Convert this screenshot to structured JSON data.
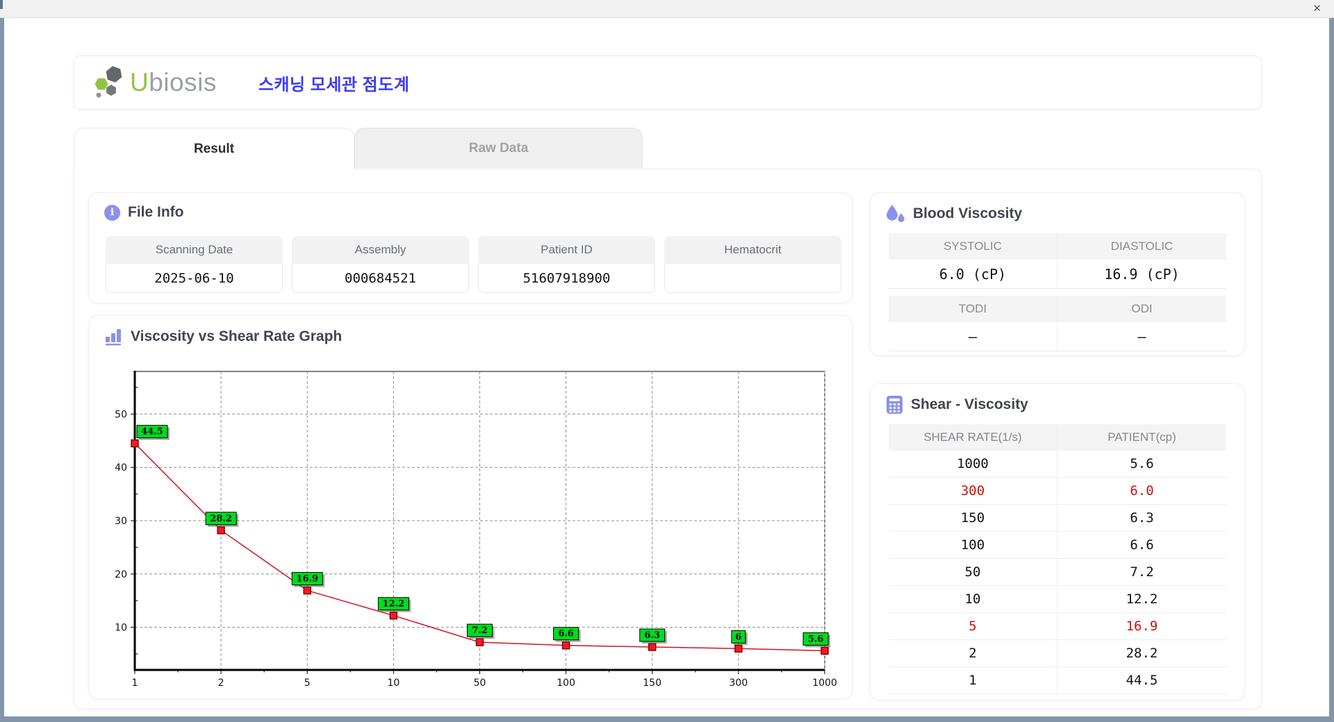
{
  "window": {
    "close_glyph": "✕"
  },
  "header": {
    "brand_u": "U",
    "brand_rest": "biosis",
    "title_ko": "스캐닝 모세관 점도계"
  },
  "tabs": [
    {
      "label": "Result",
      "active": true
    },
    {
      "label": "Raw Data",
      "active": false
    }
  ],
  "file_info": {
    "title": "File Info",
    "fields": [
      {
        "label": "Scanning Date",
        "value": "2025-06-10"
      },
      {
        "label": "Assembly",
        "value": "000684521"
      },
      {
        "label": "Patient ID",
        "value": "51607918900"
      },
      {
        "label": "Hematocrit",
        "value": ""
      }
    ]
  },
  "blood_viscosity": {
    "title": "Blood Viscosity",
    "groups": [
      {
        "cells": [
          {
            "label": "SYSTOLIC",
            "value": "6.0 (cP)"
          },
          {
            "label": "DIASTOLIC",
            "value": "16.9 (cP)"
          }
        ]
      },
      {
        "cells": [
          {
            "label": "TODI",
            "value": "–"
          },
          {
            "label": "ODI",
            "value": "–"
          }
        ]
      }
    ]
  },
  "shear_viscosity": {
    "title": "Shear - Viscosity",
    "columns": [
      "SHEAR RATE(1/s)",
      "PATIENT(cp)"
    ],
    "highlight_color": "#cc1111",
    "rows": [
      {
        "shear_rate": "1000",
        "patient": "5.6",
        "highlight": false
      },
      {
        "shear_rate": "300",
        "patient": "6.0",
        "highlight": true
      },
      {
        "shear_rate": "150",
        "patient": "6.3",
        "highlight": false
      },
      {
        "shear_rate": "100",
        "patient": "6.6",
        "highlight": false
      },
      {
        "shear_rate": "50",
        "patient": "7.2",
        "highlight": false
      },
      {
        "shear_rate": "10",
        "patient": "12.2",
        "highlight": false
      },
      {
        "shear_rate": "5",
        "patient": "16.9",
        "highlight": true
      },
      {
        "shear_rate": "2",
        "patient": "28.2",
        "highlight": false
      },
      {
        "shear_rate": "1",
        "patient": "44.5",
        "highlight": false
      }
    ]
  },
  "chart_data": {
    "type": "line",
    "title": "Viscosity vs Shear Rate Graph",
    "xlabel": "",
    "ylabel": "",
    "x_categories": [
      "1",
      "2",
      "5",
      "10",
      "50",
      "100",
      "150",
      "300",
      "1000"
    ],
    "values": [
      44.5,
      28.2,
      16.9,
      12.2,
      7.2,
      6.6,
      6.3,
      6.0,
      5.6
    ],
    "point_labels": [
      "44.5",
      "28.2",
      "16.9",
      "12.2",
      "7.2",
      "6.6",
      "6.3",
      "6",
      "5.6"
    ],
    "y_ticks": [
      10,
      20,
      30,
      40,
      50
    ],
    "y_minor_step": 5,
    "y_range": [
      2,
      58
    ],
    "grid": "dashed",
    "legend": "none",
    "line_color": "#d01428",
    "marker_color": "#ee1c25",
    "marker_border": "#8b0000",
    "label_bg": "#00dc1e"
  }
}
